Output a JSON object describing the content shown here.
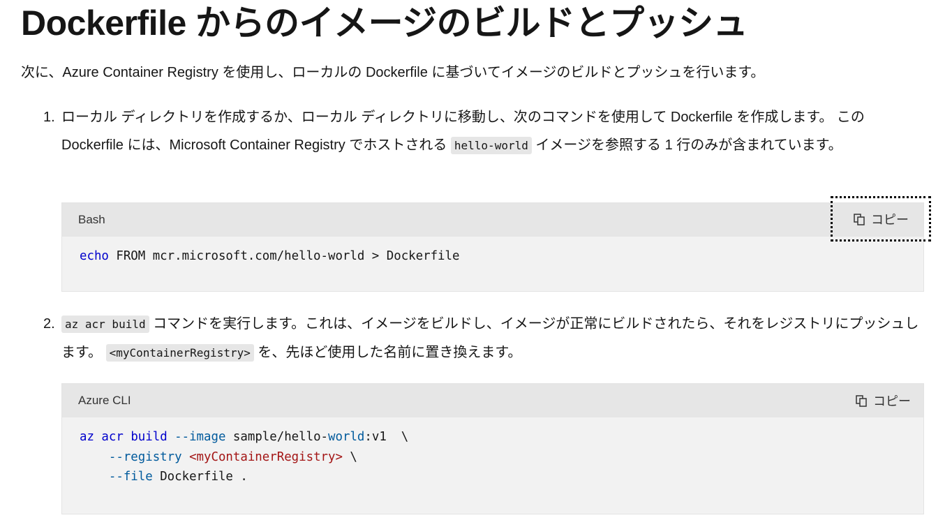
{
  "page_title": "Dockerfile からのイメージのビルドとプッシュ",
  "intro": "次に、Azure Container Registry を使用し、ローカルの Dockerfile に基づいてイメージのビルドとプッシュを行います。",
  "step1": {
    "number": "1.",
    "text_before": "ローカル ディレクトリを作成するか、ローカル ディレクトリに移動し、次のコマンドを使用して Dockerfile を作成します。 この Dockerfile には、Microsoft Container Registry でホストされる ",
    "inline_code": "hello-world",
    "text_after": " イメージを参照する 1 行のみが含まれています。"
  },
  "code1": {
    "language": "Bash",
    "copy_label": "コピー",
    "echo": "echo",
    "rest": " FROM mcr.microsoft.com/hello-world > Dockerfile"
  },
  "step2": {
    "number": "2.",
    "inline_code1": "az acr build",
    "text_mid": " コマンドを実行します。これは、イメージをビルドし、イメージが正常にビルドされたら、それをレジストリにプッシュします。 ",
    "inline_code2": "<myContainerRegistry>",
    "text_after": " を、先ほど使用した名前に置き換えます。"
  },
  "code2": {
    "language": "Azure CLI",
    "copy_label": "コピー",
    "l1_az": "az",
    "l1_acr": " acr",
    "l1_build": " build",
    "l1_image": " --image",
    "l1_sample": " sample/hello-",
    "l1_world": "world",
    "l1_v1": ":v1  \\",
    "l2_indent": "    ",
    "l2_registry": "--registry",
    "l2_space": " ",
    "l2_ph": "<myContainerRegistry>",
    "l2_bs": " \\",
    "l3_indent": "    ",
    "l3_file": "--file",
    "l3_rest": " Dockerfile ."
  }
}
